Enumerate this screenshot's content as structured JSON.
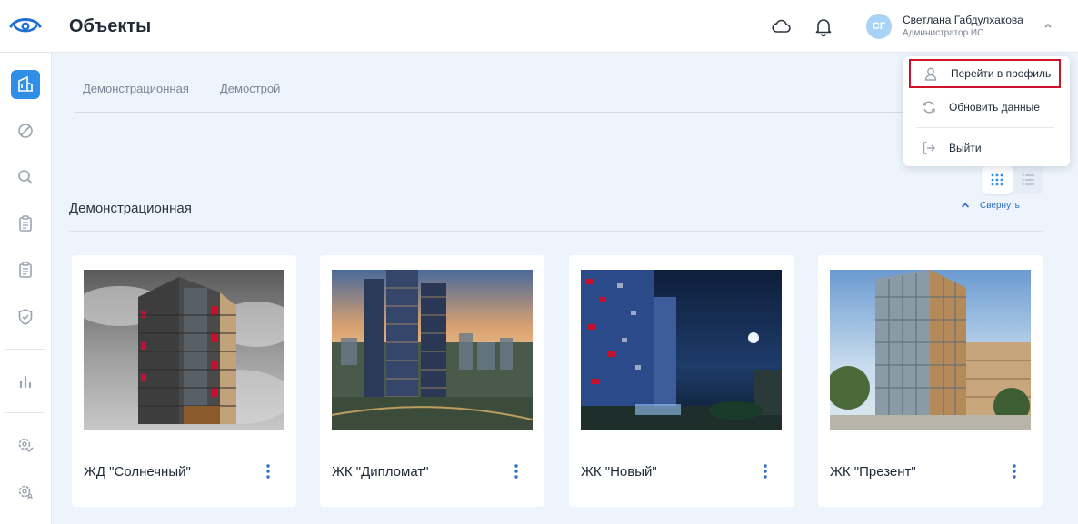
{
  "header": {
    "title": "Объекты",
    "user": {
      "initials": "СГ",
      "name": "Светлана Габдулхакова",
      "role": "Администратор ИС"
    }
  },
  "tabs": [
    {
      "label": "Демонстрационная"
    },
    {
      "label": "Демострой"
    }
  ],
  "section": {
    "title": "Демонстрационная",
    "collapse_label": "Свернуть"
  },
  "cards": [
    {
      "title": "ЖД \"Солнечный\""
    },
    {
      "title": "ЖК \"Дипломат\""
    },
    {
      "title": "ЖК \"Новый\""
    },
    {
      "title": "ЖК \"Презент\""
    }
  ],
  "dropdown": {
    "items": [
      {
        "label": "Перейти в профиль",
        "icon": "user-icon"
      },
      {
        "label": "Обновить данные",
        "icon": "refresh-icon"
      },
      {
        "label": "Выйти",
        "icon": "logout-icon"
      }
    ]
  },
  "colors": {
    "accent": "#2f8ee5",
    "highlight_border": "#d0112b",
    "background": "#eef4fc"
  }
}
